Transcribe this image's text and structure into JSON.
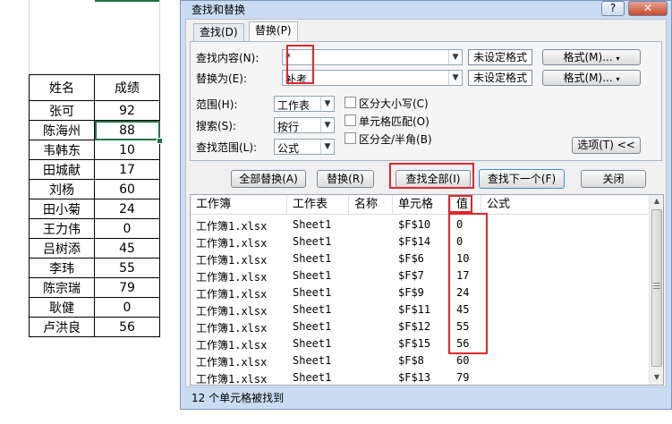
{
  "sheet": {
    "headers": [
      "姓名",
      "成绩"
    ],
    "rows": [
      [
        "张可",
        "92"
      ],
      [
        "陈海州",
        "88"
      ],
      [
        "韦韩东",
        "10"
      ],
      [
        "田城献",
        "17"
      ],
      [
        "刘杨",
        "60"
      ],
      [
        "田小菊",
        "24"
      ],
      [
        "王力伟",
        "0"
      ],
      [
        "吕树添",
        "45"
      ],
      [
        "李玮",
        "55"
      ],
      [
        "陈宗瑞",
        "79"
      ],
      [
        "耿健",
        "0"
      ],
      [
        "卢洪良",
        "56"
      ]
    ]
  },
  "dialog": {
    "title": "查找和替换",
    "help_label": "?",
    "close_label": "✕",
    "tabs": [
      "查找(D)",
      "替换(P)"
    ],
    "active_tab": "替换(P)",
    "find_label": "查找内容(N):",
    "find_value": "*",
    "replace_label": "替换为(E):",
    "replace_value": "补考",
    "no_format_label": "未设定格式",
    "format_button": "格式(M)...",
    "within_label": "范围(H):",
    "within_value": "工作表",
    "search_label": "搜索(S):",
    "search_value": "按行",
    "lookin_label": "查找范围(L):",
    "lookin_value": "公式",
    "match_case": "区分大小写(C)",
    "match_cell": "单元格匹配(O)",
    "match_width": "区分全/半角(B)",
    "options_button": "选项(T) <<",
    "replace_all_button": "全部替换(A)",
    "replace_button": "替换(R)",
    "find_all_button": "查找全部(I)",
    "find_next_button": "查找下一个(F)",
    "close_button": "关闭"
  },
  "results": {
    "columns": [
      "工作簿",
      "工作表",
      "名称",
      "单元格",
      "值",
      "公式"
    ],
    "rows": [
      [
        "工作簿1.xlsx",
        "Sheet1",
        "",
        "$F$10",
        "0"
      ],
      [
        "工作簿1.xlsx",
        "Sheet1",
        "",
        "$F$14",
        "0"
      ],
      [
        "工作簿1.xlsx",
        "Sheet1",
        "",
        "$F$6",
        "10"
      ],
      [
        "工作簿1.xlsx",
        "Sheet1",
        "",
        "$F$7",
        "17"
      ],
      [
        "工作簿1.xlsx",
        "Sheet1",
        "",
        "$F$9",
        "24"
      ],
      [
        "工作簿1.xlsx",
        "Sheet1",
        "",
        "$F$11",
        "45"
      ],
      [
        "工作簿1.xlsx",
        "Sheet1",
        "",
        "$F$12",
        "55"
      ],
      [
        "工作簿1.xlsx",
        "Sheet1",
        "",
        "$F$15",
        "56"
      ],
      [
        "工作簿1.xlsx",
        "Sheet1",
        "",
        "$F$8",
        "60"
      ],
      [
        "工作簿1.xlsx",
        "Sheet1",
        "",
        "$F$13",
        "79"
      ]
    ],
    "status": "12 个单元格被找到"
  },
  "colors": {
    "highlight_red": "#e0262b",
    "excel_green": "#217346",
    "dialog_frame": "#c9dcf2"
  }
}
